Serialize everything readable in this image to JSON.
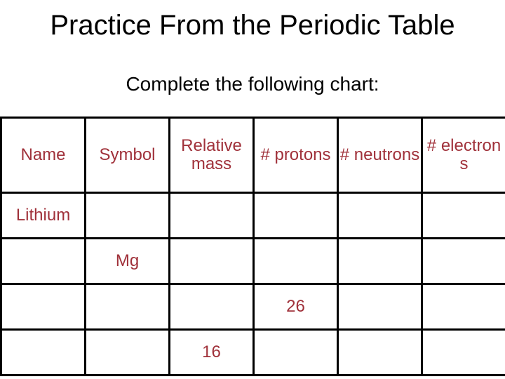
{
  "slide": {
    "title": "Practice From the Periodic Table",
    "subtitle": "Complete the following chart:",
    "text_color": "#a0313a"
  },
  "table": {
    "headers": [
      "Name",
      "Symbol",
      "Relative mass",
      "# protons",
      "# neutrons",
      "# electrons"
    ],
    "rows": [
      [
        "Lithium",
        "",
        "",
        "",
        "",
        ""
      ],
      [
        "",
        "Mg",
        "",
        "",
        "",
        ""
      ],
      [
        "",
        "",
        "",
        "26",
        "",
        ""
      ],
      [
        "",
        "",
        "16",
        "",
        "",
        ""
      ]
    ]
  }
}
